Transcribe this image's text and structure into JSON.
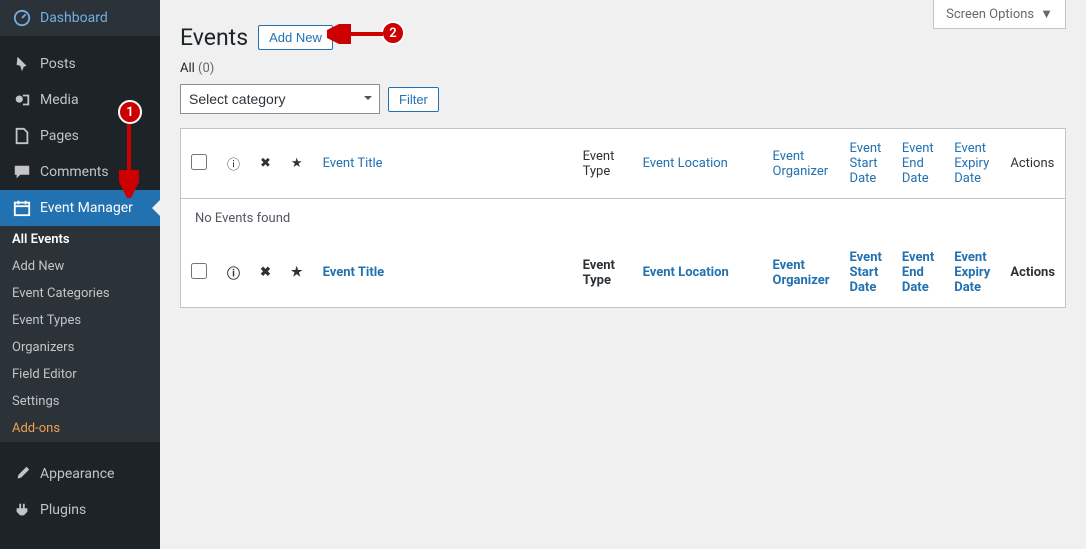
{
  "sidebar": {
    "dashboard": "Dashboard",
    "posts": "Posts",
    "media": "Media",
    "pages": "Pages",
    "comments": "Comments",
    "event_manager": "Event Manager",
    "appearance": "Appearance",
    "plugins": "Plugins",
    "submenu": {
      "all_events": "All Events",
      "add_new": "Add New",
      "categories": "Event Categories",
      "types": "Event Types",
      "organizers": "Organizers",
      "field_editor": "Field Editor",
      "settings": "Settings",
      "addons": "Add-ons"
    }
  },
  "header": {
    "screen_options": "Screen Options",
    "page_title": "Events",
    "add_new": "Add New"
  },
  "filters": {
    "status_label": "All",
    "status_count": "(0)",
    "category_placeholder": "Select category",
    "filter_btn": "Filter"
  },
  "table": {
    "headers": {
      "title": "Event Title",
      "type": "Event Type",
      "location": "Event Location",
      "organizer": "Event Organizer",
      "start": "Event Start Date",
      "end": "Event End Date",
      "expiry": "Event Expiry Date",
      "actions": "Actions"
    },
    "no_rows": "No Events found"
  },
  "annotations": {
    "badge1": "1",
    "badge2": "2"
  }
}
